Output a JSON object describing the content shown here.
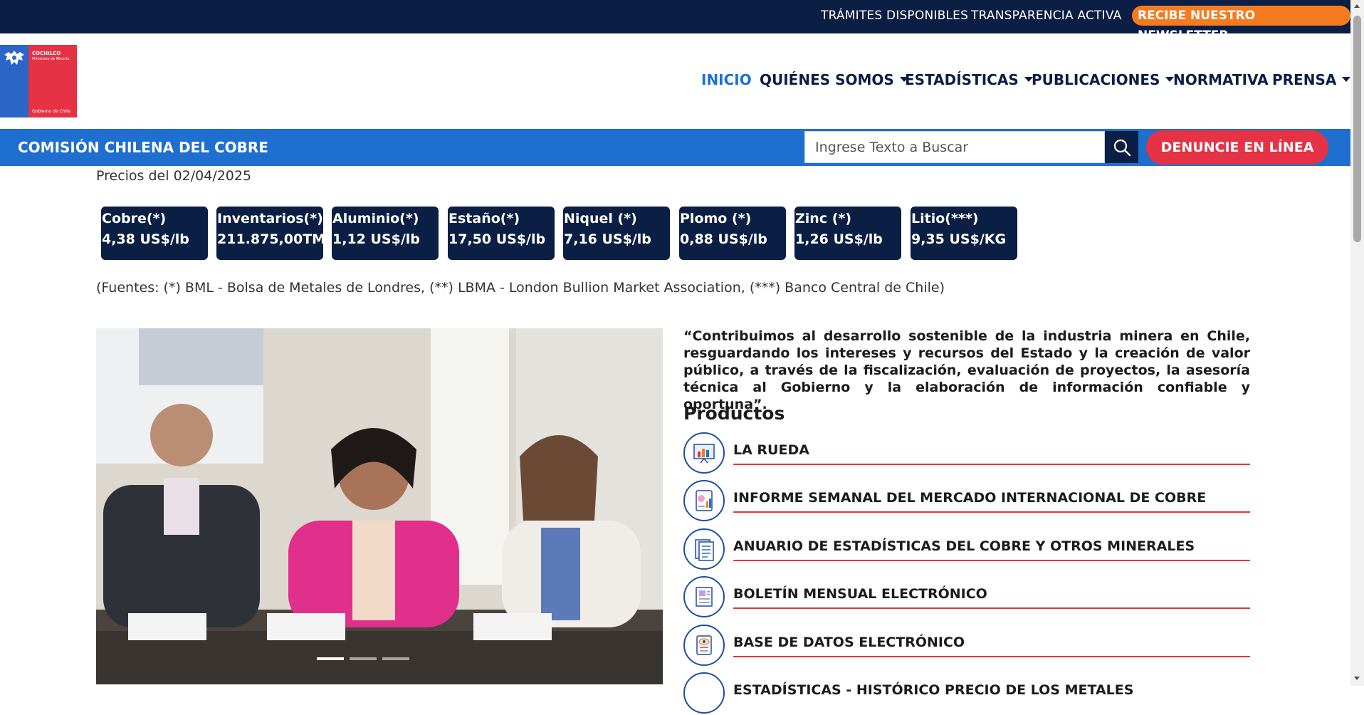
{
  "topbar": {
    "links": [
      "TRÁMITES DISPONIBLES",
      "TRANSPARENCIA ACTIVA"
    ],
    "newsletter": "RECIBE NUESTRO NEWSLETTER"
  },
  "logo": {
    "name": "COCHILCO",
    "ministry": "Ministerio de Minería",
    "government": "Gobierno de Chile"
  },
  "nav": {
    "items": [
      {
        "label": "INICIO",
        "active": true
      },
      {
        "label": "QUIÉNES SOMOS",
        "dropdown": true
      },
      {
        "label": "ESTADÍSTICAS",
        "dropdown": true
      },
      {
        "label": "PUBLICACIONES",
        "dropdown": true
      },
      {
        "label": "NORMATIVA"
      },
      {
        "label": "PRENSA",
        "dropdown": true
      }
    ]
  },
  "bluebar": {
    "org": "COMISIÓN CHILENA DEL COBRE",
    "search_placeholder": "Ingrese Texto a Buscar",
    "denuncie": "DENUNCIE EN LÍNEA"
  },
  "prices": {
    "date_label": "Precios del 02/04/2025",
    "metals": [
      {
        "name": "Cobre(*)",
        "value": "4,38 US$/lb"
      },
      {
        "name": "Inventarios(*)",
        "value": "211.875,00TM"
      },
      {
        "name": "Aluminio(*)",
        "value": "1,12 US$/lb"
      },
      {
        "name": "Estaño(*)",
        "value": "17,50 US$/lb"
      },
      {
        "name": "Niquel (*)",
        "value": "7,16 US$/lb"
      },
      {
        "name": "Plomo (*)",
        "value": "0,88 US$/lb"
      },
      {
        "name": "Zinc (*)",
        "value": "1,26 US$/lb"
      },
      {
        "name": "Litio(***)",
        "value": "9,35 US$/KG"
      }
    ],
    "sources": "(Fuentes: (*) BML - Bolsa de Metales de Londres, (**) LBMA - London Bullion Market Association, (***) Banco Central de Chile)"
  },
  "mission": "“Contribuimos al desarrollo sostenible de la industria minera en Chile, resguardando los intereses y recursos del Estado y la creación de valor público, a través de la fiscalización, evaluación de proyectos, la asesoría técnica al Gobierno y la elaboración de información confiable y oportuna”.",
  "products": {
    "title": "Productos",
    "items": [
      {
        "label": "LA RUEDA",
        "icon": "presentation-chart-icon"
      },
      {
        "label": "INFORME SEMANAL DEL MERCADO INTERNACIONAL DE COBRE",
        "icon": "report-analytics-icon"
      },
      {
        "label": "ANUARIO DE ESTADÍSTICAS DEL COBRE Y OTROS MINERALES",
        "icon": "document-list-icon"
      },
      {
        "label": "BOLETÍN MENSUAL ELECTRÓNICO",
        "icon": "newsletter-icon"
      },
      {
        "label": "BASE DE DATOS ELECTRÓNICO",
        "icon": "database-eye-icon"
      },
      {
        "label": "ESTADÍSTICAS - HISTÓRICO PRECIO DE LOS METALES",
        "icon": "history-chart-icon"
      }
    ]
  },
  "colors": {
    "navy": "#0b1e44",
    "blue": "#1e6fd0",
    "red": "#e63245",
    "orange": "#f47b20"
  }
}
